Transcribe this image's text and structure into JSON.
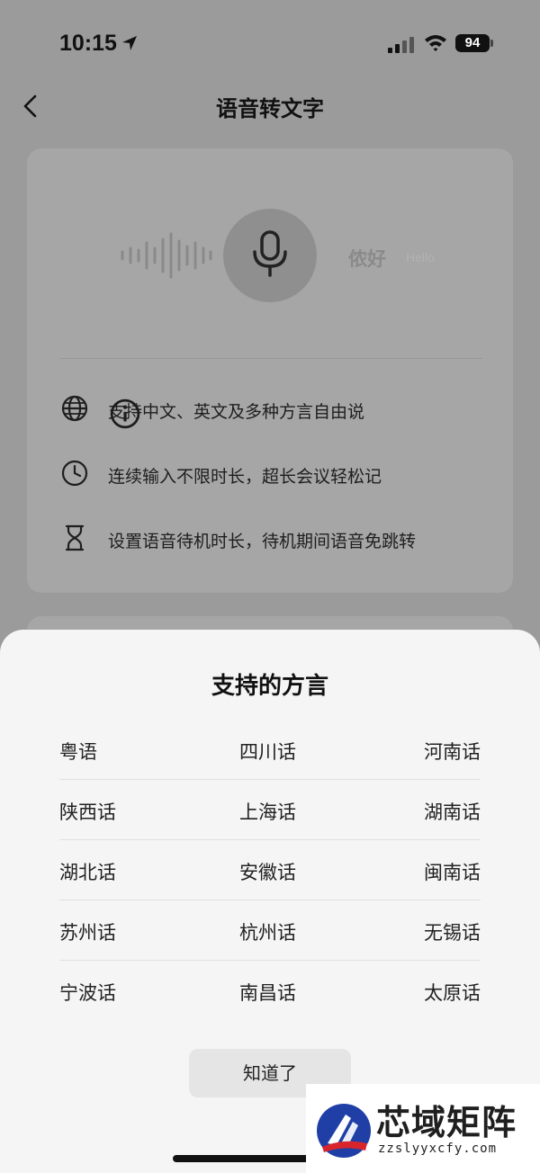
{
  "status_bar": {
    "time": "10:15",
    "battery": "94",
    "icons": [
      "location-arrow-icon",
      "cellular-signal-icon",
      "wifi-icon",
      "battery-icon"
    ]
  },
  "nav": {
    "title": "语音转文字",
    "back_icon": "chevron-left-icon"
  },
  "demo": {
    "greeting_cn": "侬好",
    "greeting_en": "Hello",
    "icons": [
      "sound-wave-icon",
      "microphone-icon"
    ]
  },
  "features": [
    {
      "icon": "globe-icon",
      "text": "支持中文、英文及多种方言自由说",
      "has_info": true
    },
    {
      "icon": "clock-icon",
      "text": "连续输入不限时长，超长会议轻松记",
      "has_info": false
    },
    {
      "icon": "hourglass-icon",
      "text": "设置语音待机时长，待机期间语音免跳转",
      "has_info": false
    }
  ],
  "sheet": {
    "title": "支持的方言",
    "dialects": [
      [
        "粤语",
        "四川话",
        "河南话"
      ],
      [
        "陕西话",
        "上海话",
        "湖南话"
      ],
      [
        "湖北话",
        "安徽话",
        "闽南话"
      ],
      [
        "苏州话",
        "杭州话",
        "无锡话"
      ],
      [
        "宁波话",
        "南昌话",
        "太原话"
      ]
    ],
    "confirm_label": "知道了"
  },
  "watermark": {
    "name": "芯域矩阵",
    "url": "zzslyyxcfy.com"
  },
  "colors": {
    "overlay": "#9b9b9b",
    "card": "#a6a6a6",
    "sheet": "#f5f5f5",
    "button": "#e5e5e5"
  }
}
